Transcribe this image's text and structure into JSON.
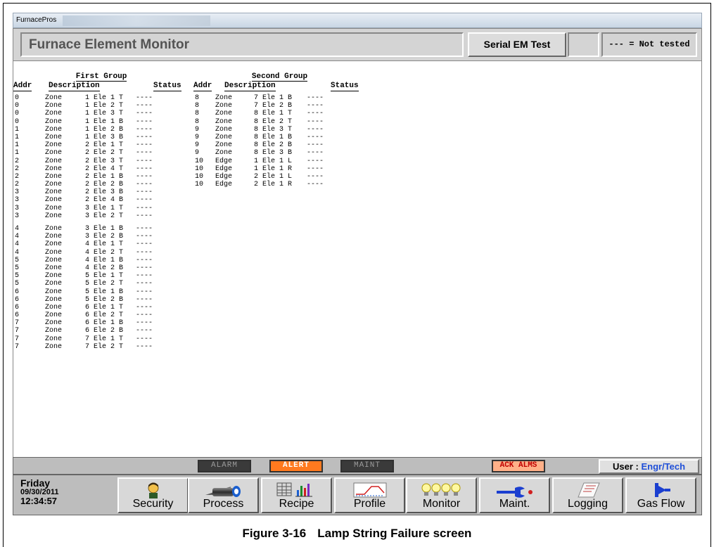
{
  "window": {
    "app_name": "FurnacePros"
  },
  "header": {
    "title": "Furnace Element Monitor",
    "serial_button": "Serial EM Test",
    "legend": "--- = Not tested"
  },
  "columns": {
    "addr": "Addr",
    "description": "Description",
    "status": "Status"
  },
  "first_group": {
    "title": "First Group",
    "rows": [
      [
        "0",
        "Zone",
        "1 Ele 1 T",
        "----"
      ],
      [
        "0",
        "Zone",
        "1 Ele 2 T",
        "----"
      ],
      [
        "0",
        "Zone",
        "1 Ele 3 T",
        "----"
      ],
      [
        "0",
        "Zone",
        "1 Ele 1 B",
        "----"
      ],
      [
        "1",
        "Zone",
        "1 Ele 2 B",
        "----"
      ],
      [
        "1",
        "Zone",
        "1 Ele 3 B",
        "----"
      ],
      [
        "1",
        "Zone",
        "2 Ele 1 T",
        "----"
      ],
      [
        "1",
        "Zone",
        "2 Ele 2 T",
        "----"
      ],
      [
        "2",
        "Zone",
        "2 Ele 3 T",
        "----"
      ],
      [
        "2",
        "Zone",
        "2 Ele 4 T",
        "----"
      ],
      [
        "2",
        "Zone",
        "2 Ele 1 B",
        "----"
      ],
      [
        "2",
        "Zone",
        "2 Ele 2 B",
        "----"
      ],
      [
        "3",
        "Zone",
        "2 Ele 3 B",
        "----"
      ],
      [
        "3",
        "Zone",
        "2 Ele 4 B",
        "----"
      ],
      [
        "3",
        "Zone",
        "3 Ele 1 T",
        "----"
      ],
      [
        "3",
        "Zone",
        "3 Ele 2 T",
        "----"
      ],
      [
        "4",
        "Zone",
        "3 Ele 1 B",
        "----"
      ],
      [
        "4",
        "Zone",
        "3 Ele 2 B",
        "----"
      ],
      [
        "4",
        "Zone",
        "4 Ele 1 T",
        "----"
      ],
      [
        "4",
        "Zone",
        "4 Ele 2 T",
        "----"
      ],
      [
        "5",
        "Zone",
        "4 Ele 1 B",
        "----"
      ],
      [
        "5",
        "Zone",
        "4 Ele 2 B",
        "----"
      ],
      [
        "5",
        "Zone",
        "5 Ele 1 T",
        "----"
      ],
      [
        "5",
        "Zone",
        "5 Ele 2 T",
        "----"
      ],
      [
        "6",
        "Zone",
        "5 Ele 1 B",
        "----"
      ],
      [
        "6",
        "Zone",
        "5 Ele 2 B",
        "----"
      ],
      [
        "6",
        "Zone",
        "6 Ele 1 T",
        "----"
      ],
      [
        "6",
        "Zone",
        "6 Ele 2 T",
        "----"
      ],
      [
        "7",
        "Zone",
        "6 Ele 1 B",
        "----"
      ],
      [
        "7",
        "Zone",
        "6 Ele 2 B",
        "----"
      ],
      [
        "7",
        "Zone",
        "7 Ele 1 T",
        "----"
      ],
      [
        "7",
        "Zone",
        "7 Ele 2 T",
        "----"
      ]
    ]
  },
  "second_group": {
    "title": "Second  Group",
    "rows": [
      [
        "8",
        "Zone",
        "7 Ele 1 B",
        "----"
      ],
      [
        "8",
        "Zone",
        "7 Ele 2 B",
        "----"
      ],
      [
        "8",
        "Zone",
        "8 Ele 1 T",
        "----"
      ],
      [
        "8",
        "Zone",
        "8 Ele 2 T",
        "----"
      ],
      [
        "9",
        "Zone",
        "8 Ele 3 T",
        "----"
      ],
      [
        "9",
        "Zone",
        "8 Ele 1 B",
        "----"
      ],
      [
        "9",
        "Zone",
        "8 Ele 2 B",
        "----"
      ],
      [
        "9",
        "Zone",
        "8 Ele 3 B",
        "----"
      ],
      [
        "10",
        "Edge",
        "1 Ele 1 L",
        "----"
      ],
      [
        "10",
        "Edge",
        "1 Ele 1 R",
        "----"
      ],
      [
        "10",
        "Edge",
        "2 Ele 1 L",
        "----"
      ],
      [
        "10",
        "Edge",
        "2 Ele 1 R",
        "----"
      ]
    ]
  },
  "alarm_bar": {
    "alarm": "ALARM",
    "alert": "ALERT",
    "maint": "MAINT",
    "ack": "ACK ALMS",
    "user_label": "User : ",
    "user_value": "Engr/Tech"
  },
  "datetime": {
    "day": "Friday",
    "date": "09/30/2011",
    "time": "12:34:57"
  },
  "nav": [
    {
      "label": "Security",
      "icon": "person-icon"
    },
    {
      "label": "Process",
      "icon": "pipe-icon"
    },
    {
      "label": "Recipe",
      "icon": "recipe-chart-icon"
    },
    {
      "label": "Profile",
      "icon": "profile-graph-icon"
    },
    {
      "label": "Monitor",
      "icon": "lamp-icon"
    },
    {
      "label": "Maint.",
      "icon": "wrench-icon"
    },
    {
      "label": "Logging",
      "icon": "log-icon"
    },
    {
      "label": "Gas Flow",
      "icon": "valve-icon"
    }
  ],
  "caption": {
    "figure": "Figure 3-16",
    "text": "Lamp String Failure screen"
  },
  "colors": {
    "alert_on": "#ff7a1f",
    "user_value": "#1f4fd8",
    "ack_text": "#c00000"
  }
}
